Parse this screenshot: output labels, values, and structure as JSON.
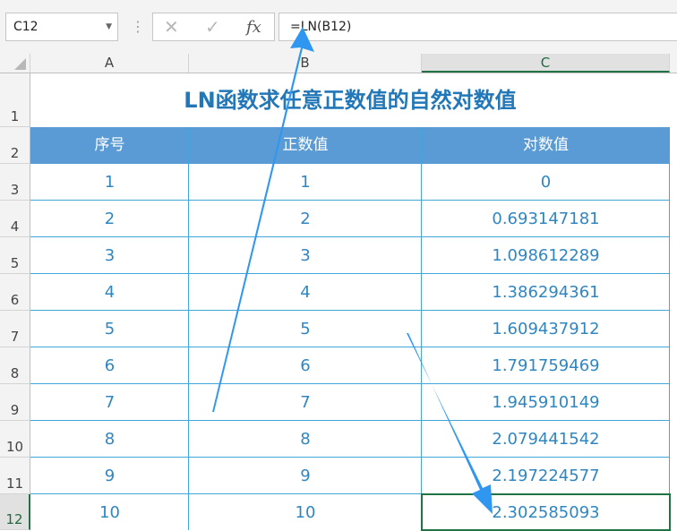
{
  "formula_bar": {
    "name_box": "C12",
    "cancel_icon": "✕",
    "enter_icon": "✓",
    "fx_label": "fx",
    "formula": "=LN(B12)"
  },
  "columns": [
    "A",
    "B",
    "C"
  ],
  "rows": [
    "1",
    "2",
    "3",
    "4",
    "5",
    "6",
    "7",
    "8",
    "9",
    "10",
    "11",
    "12"
  ],
  "sheet": {
    "title": "LN函数求任意正数值的自然对数值",
    "headers": [
      "序号",
      "正数值",
      "对数值"
    ],
    "data": [
      [
        "1",
        "1",
        "0"
      ],
      [
        "2",
        "2",
        "0.693147181"
      ],
      [
        "3",
        "3",
        "1.098612289"
      ],
      [
        "4",
        "4",
        "1.386294361"
      ],
      [
        "5",
        "5",
        "1.609437912"
      ],
      [
        "6",
        "6",
        "1.791759469"
      ],
      [
        "7",
        "7",
        "1.945910149"
      ],
      [
        "8",
        "8",
        "2.079441542"
      ],
      [
        "9",
        "9",
        "2.197224577"
      ],
      [
        "10",
        "10",
        "2.302585093"
      ]
    ]
  },
  "colors": {
    "header_fill": "#5b9bd5",
    "title_text": "#2277b8",
    "arrow": "#2f97f0",
    "selection": "#217346"
  }
}
